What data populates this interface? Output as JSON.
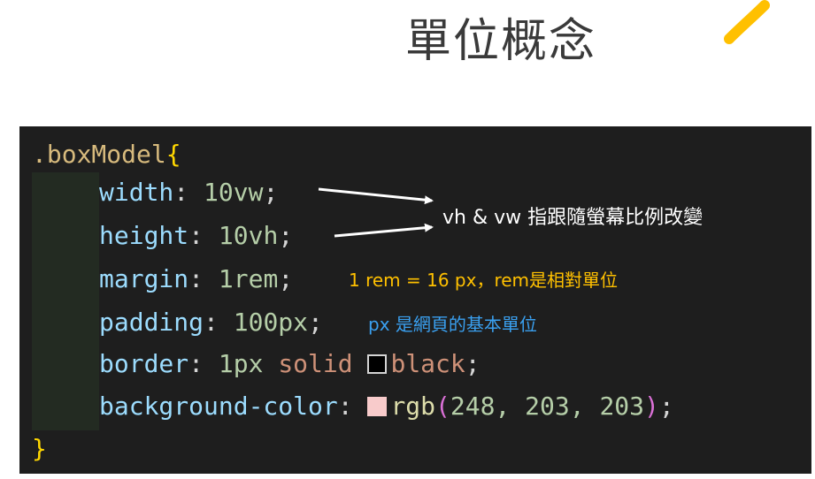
{
  "slide": {
    "title": "單位概念"
  },
  "code": {
    "selector": ".boxModel",
    "open_brace": "{",
    "close_brace": "}",
    "lines": [
      {
        "prop": "width",
        "colon": ": ",
        "value": "10vw",
        "semi": ";"
      },
      {
        "prop": "height",
        "colon": ": ",
        "value": "10vh",
        "semi": ";"
      },
      {
        "prop": "margin",
        "colon": ": ",
        "value": "1rem",
        "semi": ";"
      },
      {
        "prop": "padding",
        "colon": ": ",
        "value": "100px",
        "semi": ";"
      },
      {
        "prop": "border",
        "colon": ": ",
        "value_num": "1px",
        "value_style": "solid",
        "swatch_color": "#000000",
        "value_color": "black",
        "semi": ";"
      },
      {
        "prop": "background-color",
        "colon": ": ",
        "swatch_color": "#f8cbcb",
        "fn": "rgb",
        "paren_open": "(",
        "args": "248, 203, 203",
        "paren_close": ")",
        "semi": ";"
      }
    ]
  },
  "annotations": {
    "viewport_note": "vh & vw 指跟隨螢幕比例改變",
    "rem_note": "1 rem = 16 px，rem是相對單位",
    "px_note": "px 是網頁的基本單位"
  },
  "colors": {
    "editor_bg": "#1e1e1e",
    "rem_note": "#ffc000",
    "px_note": "#3aa0f0",
    "viewport_note": "#ffffff"
  }
}
